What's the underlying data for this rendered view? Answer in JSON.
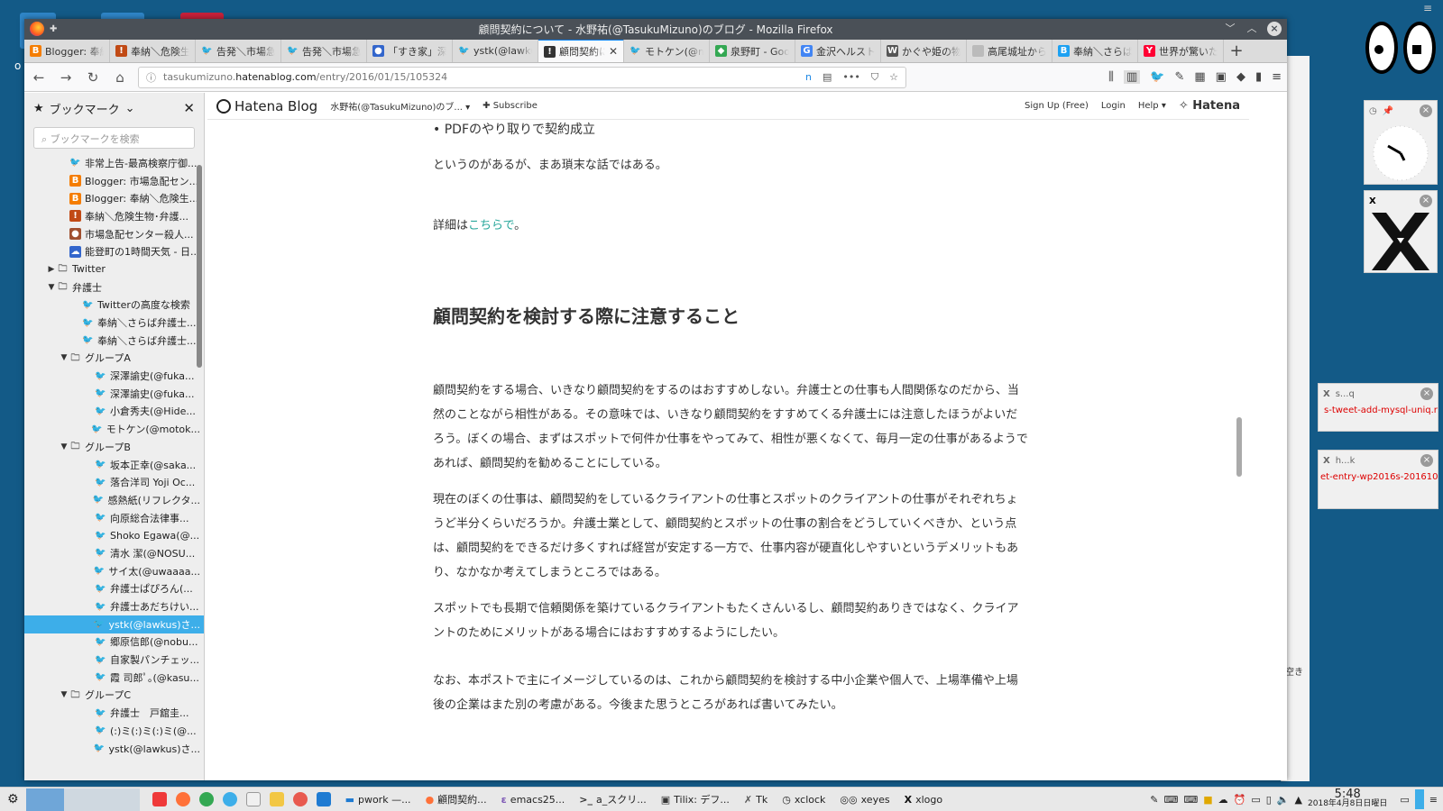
{
  "window_title": "顧問契約について - 水野祐(@TasukuMizuno)のブログ - Mozilla Firefox",
  "tabs": [
    {
      "label": "Blogger: 奉納",
      "icon": "blogger-icon",
      "color": "#f57d00"
    },
    {
      "label": "奉納＼危険生",
      "icon": "hatena-icon",
      "color": "#c14a15"
    },
    {
      "label": "告発＼市場急",
      "icon": "twitter-icon",
      "color": "#1da1f2"
    },
    {
      "label": "告発＼市場急",
      "icon": "twitter-icon",
      "color": "#1da1f2"
    },
    {
      "label": "「すき家」深夜",
      "icon": "site-icon",
      "color": "#3366cc"
    },
    {
      "label": "ystk(@lawkus)",
      "icon": "twitter-icon",
      "color": "#1da1f2"
    },
    {
      "label": "顧問契約に",
      "icon": "hatena-icon",
      "color": "#333333",
      "active": true
    },
    {
      "label": "モトケン(@m",
      "icon": "twitter-icon",
      "color": "#1da1f2"
    },
    {
      "label": "泉野町 - Goo",
      "icon": "maps-icon",
      "color": "#34a853"
    },
    {
      "label": "金沢ヘルスト",
      "icon": "google-icon",
      "color": "#4285f4"
    },
    {
      "label": "かぐや姫の物",
      "icon": "wikipedia-icon",
      "color": "#555555"
    },
    {
      "label": "高尾城址から振",
      "icon": "blank-icon",
      "color": "#bbbbbb"
    },
    {
      "label": "奉納＼さらば",
      "icon": "blogger-icon",
      "color": "#1da1f2"
    },
    {
      "label": "世界が驚いた",
      "icon": "yahoo-icon",
      "color": "#ff0033"
    }
  ],
  "url": {
    "pre": "tasukumizuno.",
    "host": "hatenablog.com",
    "path": "/entry/2016/01/15/105324"
  },
  "sidebar": {
    "title": "ブックマーク",
    "search_placeholder": "ブックマークを検索",
    "items": [
      {
        "label": "非常上告-最高検察庁御...",
        "indent": 3,
        "icon": "twitter-icon",
        "color": "#1da1f2"
      },
      {
        "label": "Blogger: 市場急配セン...",
        "indent": 3,
        "icon": "blogger-icon",
        "color": "#f57d00"
      },
      {
        "label": "Blogger: 奉納＼危険生...",
        "indent": 3,
        "icon": "blogger-icon",
        "color": "#f57d00"
      },
      {
        "label": "奉納＼危険生物･弁護...",
        "indent": 3,
        "icon": "hatena-icon",
        "color": "#c14a15"
      },
      {
        "label": "市場急配センター殺人...",
        "indent": 3,
        "icon": "site-icon",
        "color": "#a05030"
      },
      {
        "label": "能登町の1時間天気 - 日...",
        "indent": 3,
        "icon": "weather-icon",
        "color": "#3366cc"
      },
      {
        "label": "Twitter",
        "indent": 2,
        "icon": "folder-icon",
        "folder": true,
        "arrow": "▶"
      },
      {
        "label": "弁護士",
        "indent": 2,
        "icon": "folder-icon",
        "folder": true,
        "arrow": "▼"
      },
      {
        "label": "Twitterの高度な検索",
        "indent": 4,
        "icon": "twitter-icon",
        "color": "#1da1f2"
      },
      {
        "label": "奉納＼さらば弁護士...",
        "indent": 4,
        "icon": "twitter-icon",
        "color": "#1da1f2"
      },
      {
        "label": "奉納＼さらば弁護士...",
        "indent": 4,
        "icon": "twitter-icon",
        "color": "#1da1f2"
      },
      {
        "label": "グループA",
        "indent": 3,
        "icon": "folder-icon",
        "folder": true,
        "arrow": "▼"
      },
      {
        "label": "深澤諭史(@fuka...",
        "indent": 5,
        "icon": "twitter-icon",
        "color": "#1da1f2"
      },
      {
        "label": "深澤諭史(@fuka...",
        "indent": 5,
        "icon": "twitter-icon",
        "color": "#1da1f2"
      },
      {
        "label": "小倉秀夫(@Hide...",
        "indent": 5,
        "icon": "twitter-icon",
        "color": "#1da1f2"
      },
      {
        "label": "モトケン(@motok...",
        "indent": 5,
        "icon": "twitter-icon",
        "color": "#1da1f2"
      },
      {
        "label": "グループB",
        "indent": 3,
        "icon": "folder-icon",
        "folder": true,
        "arrow": "▼"
      },
      {
        "label": "坂本正幸(@saka...",
        "indent": 5,
        "icon": "twitter-icon",
        "color": "#1da1f2"
      },
      {
        "label": "落合洋司 Yoji Oc...",
        "indent": 5,
        "icon": "twitter-icon",
        "color": "#1da1f2"
      },
      {
        "label": "感熱紙(リフレクタ...",
        "indent": 5,
        "icon": "twitter-icon",
        "color": "#1da1f2"
      },
      {
        "label": "向原総合法律事...",
        "indent": 5,
        "icon": "twitter-icon",
        "color": "#1da1f2"
      },
      {
        "label": "Shoko Egawa(@...",
        "indent": 5,
        "icon": "twitter-icon",
        "color": "#1da1f2"
      },
      {
        "label": "清水 潔(@NOSU...",
        "indent": 5,
        "icon": "twitter-icon",
        "color": "#1da1f2"
      },
      {
        "label": "サイ太(@uwaaaa...",
        "indent": 5,
        "icon": "twitter-icon",
        "color": "#1da1f2"
      },
      {
        "label": "弁護士ぱぴろん(...",
        "indent": 5,
        "icon": "twitter-icon",
        "color": "#1da1f2"
      },
      {
        "label": "弁護士あだちけい...",
        "indent": 5,
        "icon": "twitter-icon",
        "color": "#1da1f2"
      },
      {
        "label": "ystk(@lawkus)さ...",
        "indent": 5,
        "icon": "twitter-icon",
        "color": "#ffffff",
        "selected": true
      },
      {
        "label": "郷原信郎(@nobu...",
        "indent": 5,
        "icon": "twitter-icon",
        "color": "#1da1f2"
      },
      {
        "label": "自家製パンチェッ...",
        "indent": 5,
        "icon": "twitter-icon",
        "color": "#1da1f2"
      },
      {
        "label": "霞 司郎ﾟ｡(@kasu...",
        "indent": 5,
        "icon": "twitter-icon",
        "color": "#1da1f2"
      },
      {
        "label": "グループC",
        "indent": 3,
        "icon": "folder-icon",
        "folder": true,
        "arrow": "▼"
      },
      {
        "label": "弁護士　戸舘圭...",
        "indent": 5,
        "icon": "twitter-icon",
        "color": "#1da1f2"
      },
      {
        "label": "(:)ミ(:)ミ(:)ミ(@...",
        "indent": 5,
        "icon": "twitter-icon",
        "color": "#1da1f2"
      },
      {
        "label": "ystk(@lawkus)さ...",
        "indent": 5,
        "icon": "twitter-icon",
        "color": "#1da1f2"
      }
    ]
  },
  "hatena_bar": {
    "logo": "Hatena Blog",
    "blog": "水野祐(@TasukuMizuno)のブ... ▾",
    "subscribe": "✚ Subscribe",
    "signup": "Sign Up (Free)",
    "login": "Login",
    "help": "Help ▾",
    "brand": "Hatena"
  },
  "article": {
    "bullet": "PDFのやり取りで契約成立",
    "p0": "というのがあるが、まあ瑣末な話ではある。",
    "detail_pre": "詳細は",
    "detail_link": "こちらで",
    "detail_post": "。",
    "heading": "顧問契約を検討する際に注意すること",
    "p1": "顧問契約をする場合、いきなり顧問契約をするのはおすすめしない。弁護士との仕事も人間関係なのだから、当然のことながら相性がある。その意味では、いきなり顧問契約をすすめてくる弁護士には注意したほうがよいだろう。ぼくの場合、まずはスポットで何件か仕事をやってみて、相性が悪くなくて、毎月一定の仕事があるようであれば、顧問契約を勧めることにしている。",
    "p2": "現在のぼくの仕事は、顧問契約をしているクライアントの仕事とスポットのクライアントの仕事がそれぞれちょうど半分くらいだろうか。弁護士業として、顧問契約とスポットの仕事の割合をどうしていくべきか、という点は、顧問契約をできるだけ多くすれば経営が安定する一方で、仕事内容が硬直化しやすいというデメリットもあり、なかなか考えてしまうところではある。",
    "p3": "スポットでも長期で信頼関係を築けているクライアントもたくさんいるし、顧問契約ありきではなく、クライアントのためにメリットがある場合にはおすすめするようにしたい。",
    "p4": "なお、本ポストで主にイメージしているのは、これから顧問契約を検討する中小企業や個人で、上場準備や上場後の企業はまた別の考慮がある。今後また思うところがあれば書いてみたい。"
  },
  "widgets": {
    "w1_title": "s...q",
    "w1_text": "s-tweet-add-mysql-uniq.rb",
    "w2_title": "h...k",
    "w2_text": "et-entry-wp2016s-201610",
    "side_text": "空き"
  },
  "taskbar": {
    "items": [
      {
        "label": "pwork —...",
        "icon": "folder-icon",
        "color": "#1e7bd2"
      },
      {
        "label": "顧問契約...",
        "icon": "firefox-icon",
        "color": "#ff7139"
      },
      {
        "label": "emacs25...",
        "icon": "emacs-icon",
        "color": "#7f5ab6"
      },
      {
        "label": "a_スクリ...",
        "icon": "terminal-icon",
        "color": "#333333"
      },
      {
        "label": "Tilix: デフ...",
        "icon": "tilix-icon",
        "color": "#333333"
      },
      {
        "label": "Tk",
        "icon": "tk-icon",
        "color": "#555555"
      },
      {
        "label": "xclock",
        "icon": "clock-icon",
        "color": "#222222"
      },
      {
        "label": "xeyes",
        "icon": "eyes-icon",
        "color": "#222222"
      },
      {
        "label": "xlogo",
        "icon": "x-icon",
        "color": "#111111"
      }
    ],
    "time": "5:48",
    "date": "2018年4月8日日曜日"
  },
  "desktop_letter": "o"
}
